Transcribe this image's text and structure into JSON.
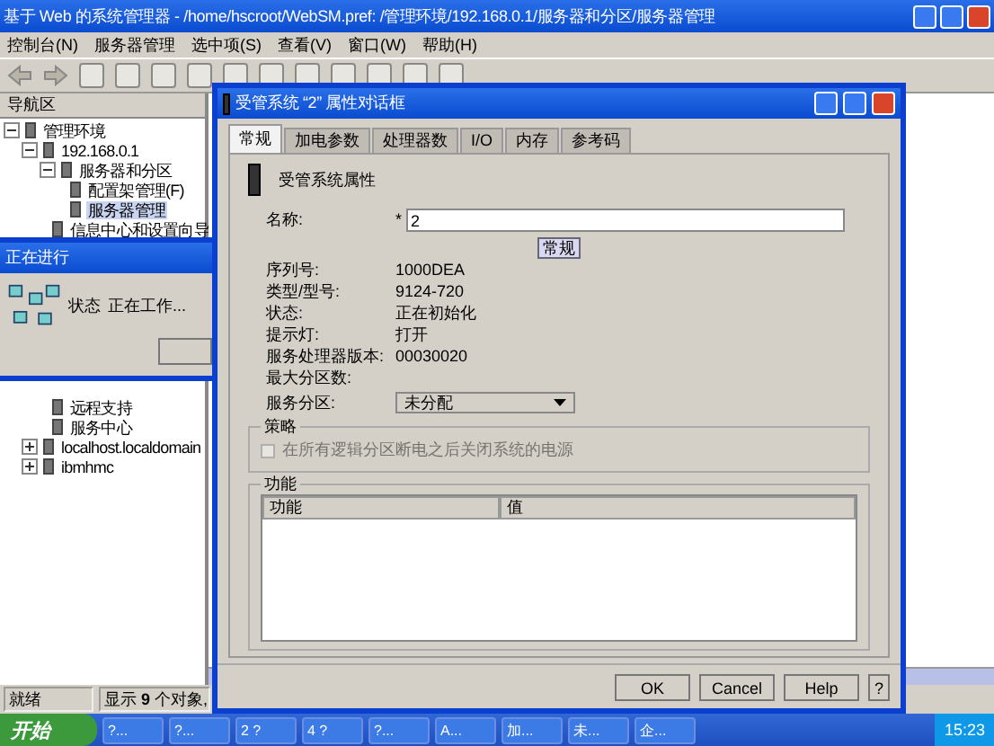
{
  "window": {
    "title": "基于 Web 的系统管理器 - /home/hscroot/WebSM.pref: /管理环境/192.168.0.1/服务器和分区/服务器管理"
  },
  "menu": [
    "控制台(N)",
    "服务器管理",
    "选中项(S)",
    "查看(V)",
    "窗口(W)",
    "帮助(H)"
  ],
  "nav": {
    "title": "导航区",
    "tree": [
      {
        "label": "管理环境",
        "expanded": true,
        "children": [
          {
            "label": "192.168.0.1",
            "expanded": true,
            "children": [
              {
                "label": "服务器和分区",
                "expanded": true,
                "children": [
                  {
                    "label": "配置架管理(F)",
                    "selected": false
                  },
                  {
                    "label": "服务器管理",
                    "selected": true
                  }
                ]
              },
              {
                "label": "信息中心和设置向导",
                "selected": false
              },
              {
                "label": "远程支持",
                "selected": false
              },
              {
                "label": "服务中心",
                "selected": false
              }
            ]
          },
          {
            "label": "localhost.localdomain",
            "expanded": false
          },
          {
            "label": "ibmhmc",
            "expanded": false
          }
        ]
      }
    ]
  },
  "status_bar": {
    "state": "就绪",
    "objects": "显示 **9** 个对象,"
  },
  "progress": {
    "title": "正在进行",
    "label": "状态",
    "value": "正在工作..."
  },
  "dialog": {
    "title": "受管系统 “2” 属性对话框",
    "tabs": [
      {
        "label": "常规",
        "selected": true
      },
      {
        "label": "加电参数",
        "selected": false
      },
      {
        "label": "处理器数",
        "selected": false
      },
      {
        "label": "I/O",
        "selected": false
      },
      {
        "label": "内存",
        "selected": false
      },
      {
        "label": "参考码",
        "selected": false
      }
    ],
    "heading": "受管系统属性",
    "name_label": "名称:",
    "required_mark": "*",
    "name_value": "2",
    "general_button": "常规",
    "properties": [
      {
        "label": "序列号:",
        "value": "1000DEA"
      },
      {
        "label": "类型/型号:",
        "value": "9124-720"
      },
      {
        "label": "状态:",
        "value": "正在初始化"
      },
      {
        "label": "提示灯:",
        "value": "打开"
      },
      {
        "label": "服务处理器版本:",
        "value": "00030020"
      },
      {
        "label": "最大分区数:"
      }
    ],
    "service_partition": {
      "label": "服务分区:",
      "value": "未分配"
    },
    "policy": {
      "title": "策略",
      "option": "在所有逻辑分区断电之后关闭系统的电源",
      "checked": false,
      "disabled": true
    },
    "capabilities": {
      "title": "功能",
      "columns": [
        "功能",
        "值"
      ]
    },
    "buttons": [
      "OK",
      "Cancel",
      "Help",
      "?"
    ]
  },
  "taskbar": {
    "start": "开始",
    "tasks": [
      "?...",
      "?...",
      "2 ?",
      "4 ?",
      "?...",
      "A...",
      "加...",
      "未...",
      "企..."
    ],
    "clock": "15:23"
  }
}
